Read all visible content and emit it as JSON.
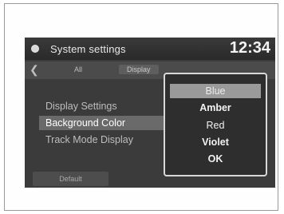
{
  "titlebar": {
    "title": "System settings",
    "clock": "12:34",
    "icon": "settings-dot-icon"
  },
  "tabs": [
    {
      "label": "All"
    },
    {
      "label": "Display"
    }
  ],
  "settings_list": {
    "items": [
      {
        "label": "Display Settings"
      },
      {
        "label": "Background Color"
      },
      {
        "label": "Track Mode Display"
      }
    ],
    "selected": "Background Color"
  },
  "footer": {
    "default_label": "Default"
  },
  "color_popup": {
    "options": [
      {
        "label": "Blue"
      },
      {
        "label": "Amber"
      },
      {
        "label": "Red"
      },
      {
        "label": "Violet"
      },
      {
        "label": "OK"
      }
    ],
    "highlighted": "Blue"
  },
  "colors": {
    "screen_bg": "#3b3b3b",
    "highlight": "#6a6a6a",
    "popup_border": "#d8d8d8"
  }
}
